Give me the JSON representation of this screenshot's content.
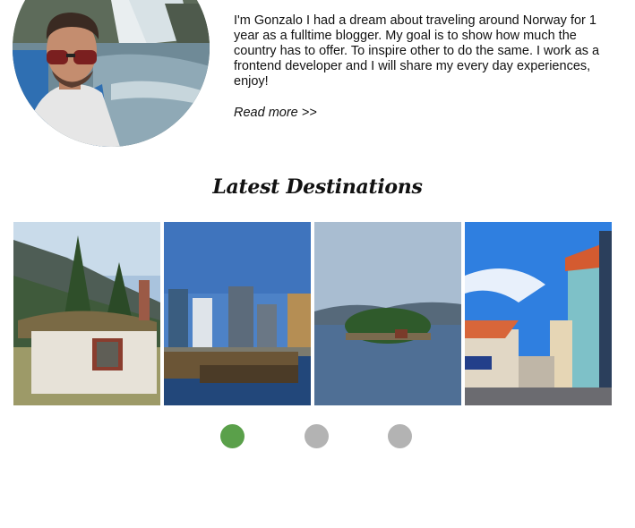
{
  "intro": {
    "text": "I'm Gonzalo I had a dream about traveling around Norway for 1 year as a fulltime blogger. My goal is to show how much the country has to offer. To inspire other to do the same. I work as a frontend developer and I will share my every day experiences, enjoy!",
    "read_more": "Read more >>"
  },
  "latest": {
    "title": "Latest Destinations"
  },
  "carousel": {
    "active_index": 0,
    "dot_count": 3,
    "active_color": "#5aa04a",
    "inactive_color": "#b3b3b3"
  }
}
